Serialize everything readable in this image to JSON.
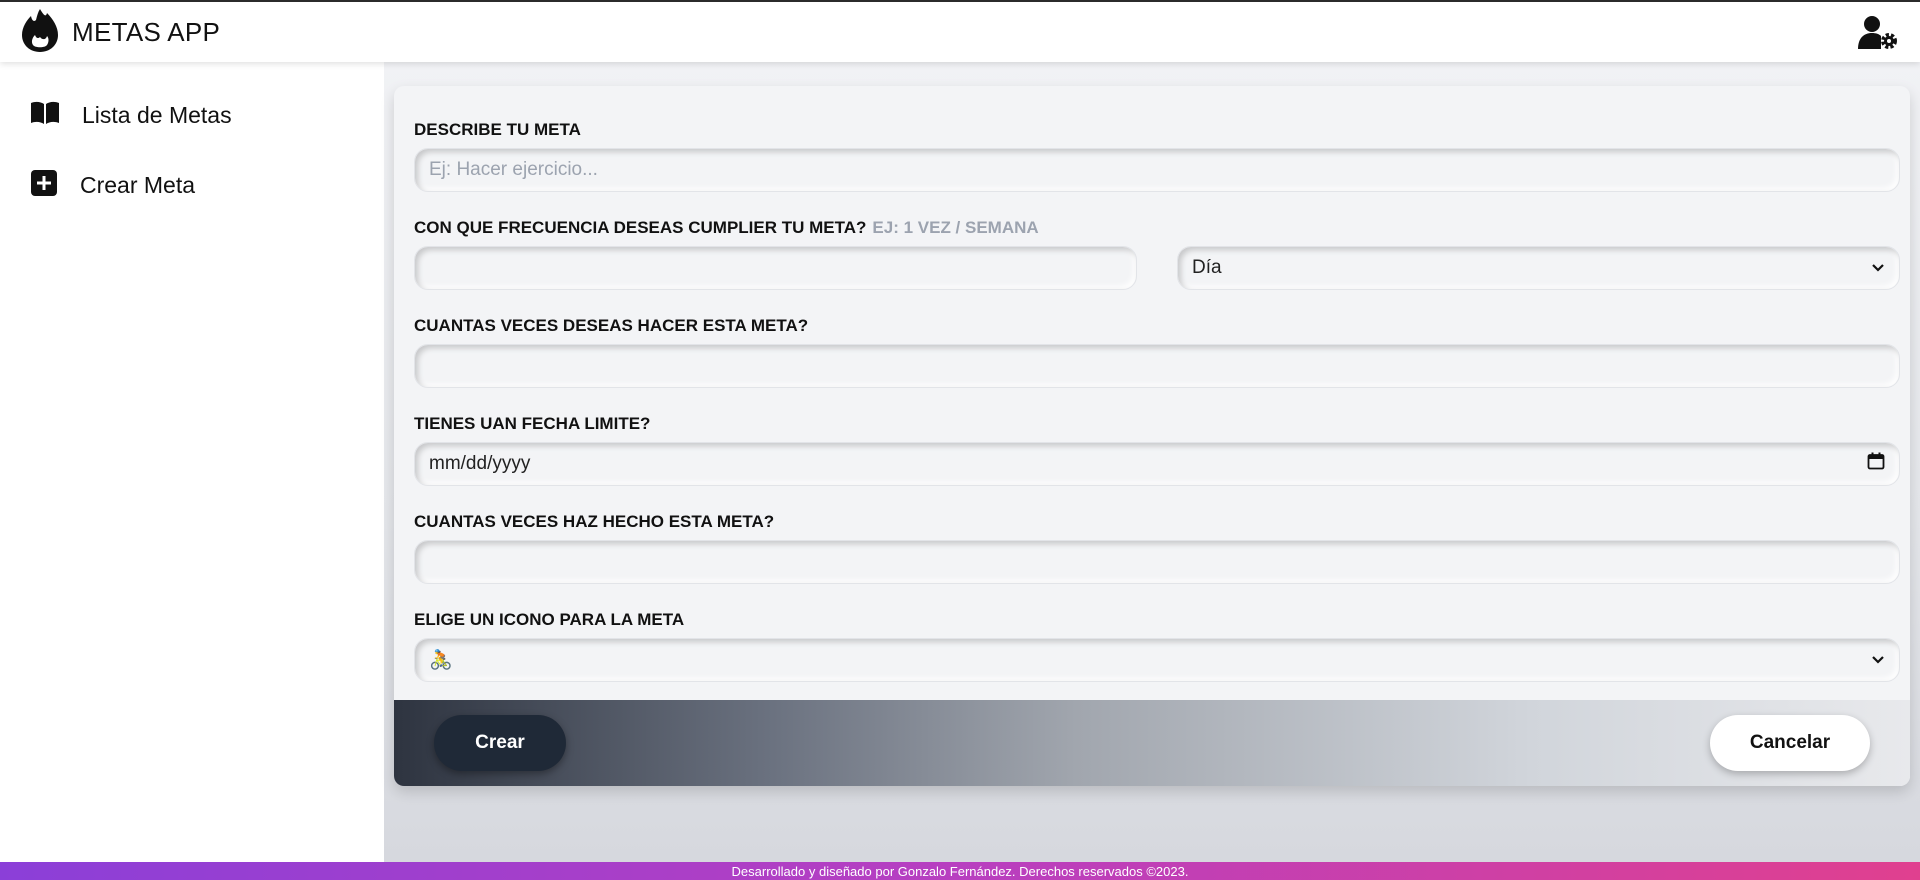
{
  "app": {
    "title": "METAS APP"
  },
  "sidebar": {
    "items": [
      {
        "label": "Lista de Metas",
        "icon": "book-open-icon"
      },
      {
        "label": "Crear Meta",
        "icon": "plus-square-icon"
      }
    ]
  },
  "form": {
    "describe_label": "DESCRIBE TU META",
    "describe_placeholder": "Ej: Hacer ejercicio...",
    "frequency_label": "CON QUE FRECUENCIA DESEAS CUMPLIER TU META?",
    "frequency_hint": "EJ: 1 VEZ / SEMANA",
    "frequency_value": "",
    "period_selected": "Día",
    "goal_count_label": "CUANTAS VECES DESEAS HACER ESTA META?",
    "goal_count_value": "",
    "deadline_label": "TIENES UAN FECHA LIMITE?",
    "deadline_placeholder": "mm/dd/yyyy",
    "done_count_label": "CUANTAS VECES HAZ HECHO ESTA META?",
    "done_count_value": "",
    "icon_label": "ELIGE UN ICONO PARA LA META",
    "icon_selected": "🚴"
  },
  "actions": {
    "create_label": "Crear",
    "cancel_label": "Cancelar"
  },
  "footer": {
    "text": "Desarrollado y diseñado por Gonzalo Fernández. Derechos reservados ©2023."
  },
  "colors": {
    "primary_button": "#1f2937",
    "footer_gradient_start": "#8b3fd8",
    "footer_gradient_end": "#e0408f"
  }
}
